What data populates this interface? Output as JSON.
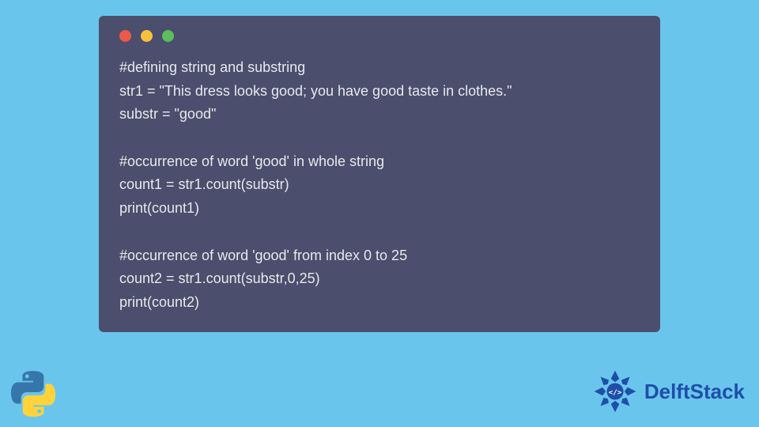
{
  "code": {
    "lines": [
      "#defining string and substring",
      "str1 = \"This dress looks good; you have good taste in clothes.\"",
      "substr = \"good\"",
      "",
      "#occurrence of word 'good' in whole string",
      "count1 = str1.count(substr)",
      "print(count1)",
      "",
      "#occurrence of word 'good' from index 0 to 25",
      "count2 = str1.count(substr,0,25)",
      "print(count2)"
    ]
  },
  "branding": {
    "name": "DelftStack"
  }
}
